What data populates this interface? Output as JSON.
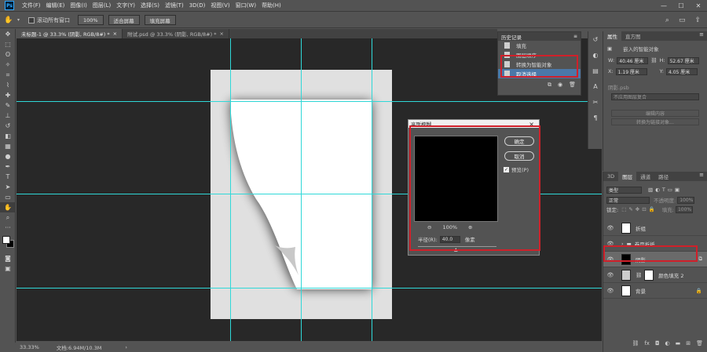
{
  "menu": [
    "文件(F)",
    "编辑(E)",
    "图像(I)",
    "图层(L)",
    "文字(Y)",
    "选择(S)",
    "滤镜(T)",
    "3D(D)",
    "视图(V)",
    "窗口(W)",
    "帮助(H)"
  ],
  "options": {
    "scroll_all": "滚动所有窗口",
    "zoom": "100%",
    "fit_screen": "适合屏幕",
    "fill_screen": "填充屏幕"
  },
  "tabs": [
    {
      "label": "未标题-1 @ 33.3% (阴影, RGB/8#) *",
      "close": "×"
    },
    {
      "label": "附试.psd @ 33.3% (阴影, RGB/8#) *",
      "close": "×"
    }
  ],
  "status": {
    "zoom": "33.33%",
    "doc": "文档:6.94M/10.3M"
  },
  "history": {
    "title": "历史记录",
    "items": [
      "填充",
      "图层顺序",
      "转换为智能对象",
      "取消选择"
    ]
  },
  "properties": {
    "tabs": [
      "属性",
      "直方图"
    ],
    "embedded": "嵌入的智能对象",
    "w_label": "W:",
    "w": "40.46 厘米",
    "h_label": "H:",
    "h": "52.67 厘米",
    "x_label": "X:",
    "x": "1.19 厘米",
    "y_label": "Y:",
    "y": "4.05 厘米",
    "layer_name": "阴影.psb",
    "comp": "不应用图层复合",
    "edit_content": "编辑内容",
    "convert": "转换为链接对象..."
  },
  "layers": {
    "tabs": [
      "3D",
      "图层",
      "通道",
      "路径"
    ],
    "kind": "类型",
    "blend": "正常",
    "opacity_label": "不透明度:",
    "opacity": "100%",
    "lock_label": "锁定:",
    "fill_label": "填充:",
    "fill": "100%",
    "items": [
      "折组",
      "卷页折纸",
      "阴影",
      "颜色填充 2",
      "背景"
    ]
  },
  "dialog": {
    "title": "高斯模糊",
    "ok": "确定",
    "cancel": "取消",
    "preview": "预览(P)",
    "zoom": "100%",
    "radius_label": "半径(R):",
    "radius": "40.0",
    "unit": "像素"
  }
}
